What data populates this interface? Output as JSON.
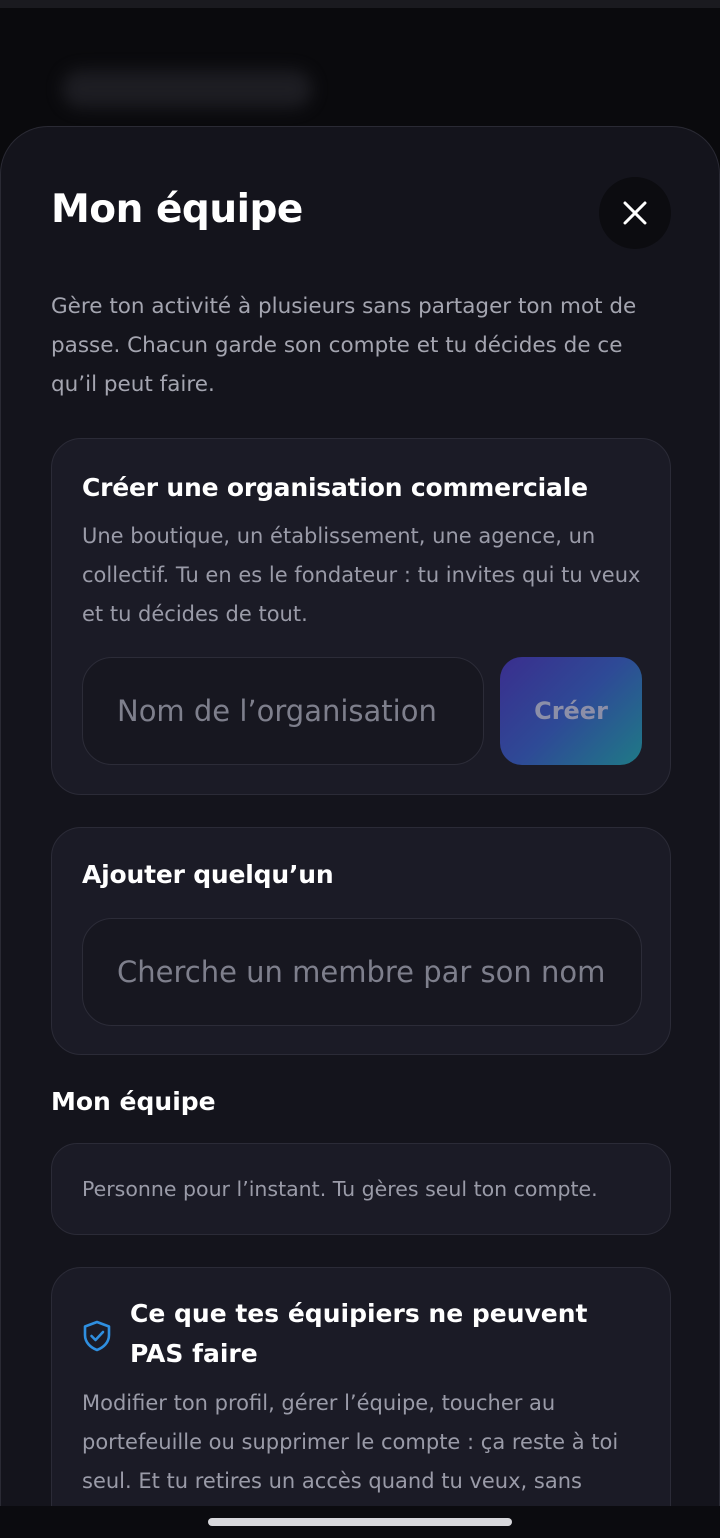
{
  "sheet": {
    "title": "Mon équipe",
    "intro": "Gère ton activité à plusieurs sans partager ton mot de passe. Chacun garde son compte et tu décides de ce qu’il peut faire."
  },
  "create_org": {
    "title": "Créer une organisation commerciale",
    "description": "Une boutique, un établissement, une agence, un collectif. Tu en es le fondateur : tu invites qui tu veux et tu décides de tout.",
    "input_placeholder": "Nom de l’organisation",
    "input_value": "",
    "button_label": "Créer"
  },
  "add_member": {
    "title": "Ajouter quelqu’un",
    "search_placeholder": "Cherche un membre par son nom",
    "search_value": ""
  },
  "team": {
    "title": "Mon équipe",
    "empty_text": "Personne pour l’instant. Tu gères seul ton compte."
  },
  "restrictions": {
    "icon": "shield-check-icon",
    "title": "Ce que tes équipiers ne peuvent PAS faire",
    "description": "Modifier ton profil, gérer l’équipe, toucher au portefeuille ou supprimer le compte : ça reste à toi seul. Et tu retires un accès quand tu veux, sans"
  },
  "colors": {
    "accent": "#2f8fe0",
    "button_gradient_start": "#3a2e8e",
    "button_gradient_end": "#1f7a86",
    "sheet_bg": "#14141c",
    "card_bg": "#1b1b26"
  }
}
